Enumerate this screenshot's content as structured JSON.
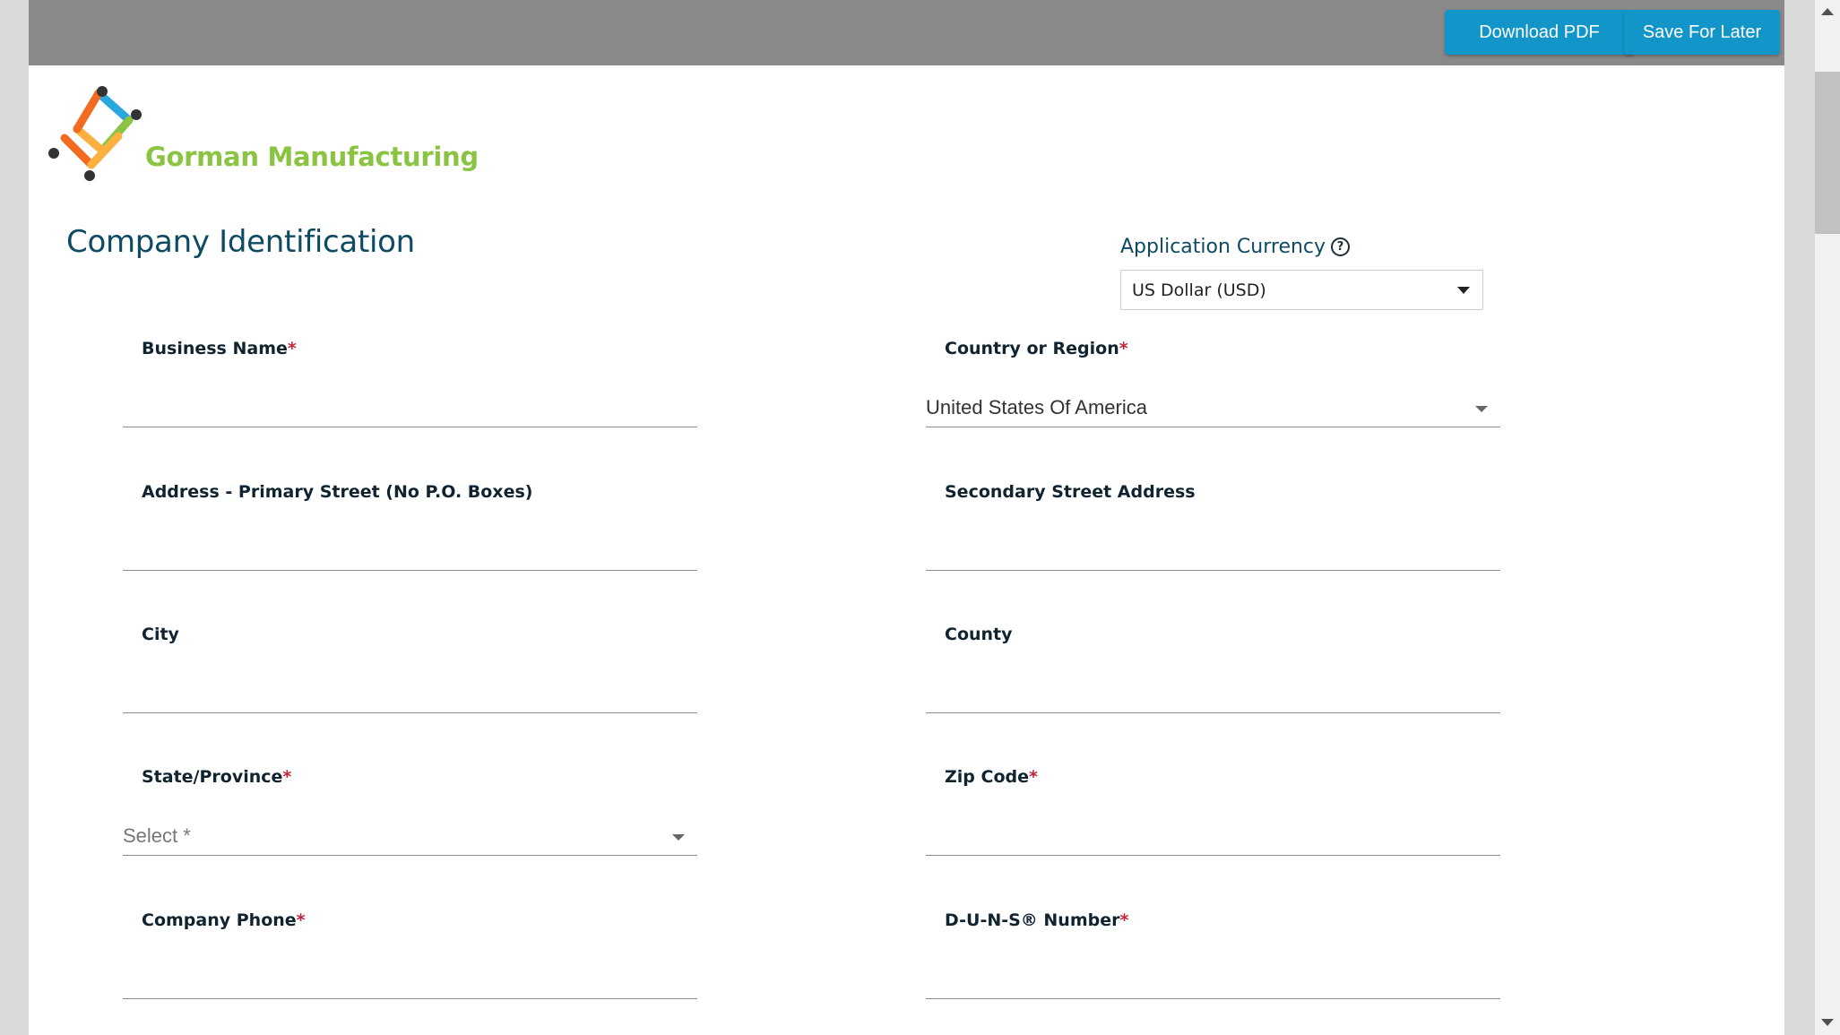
{
  "toolbar": {
    "download_pdf_label": "Download PDF",
    "save_later_label": "Save For Later"
  },
  "brand": {
    "name": "Gorman Manufacturing",
    "colors": {
      "name_green": "#8bc443",
      "logo_blue": "#29a8df",
      "logo_orange": "#f26b21",
      "logo_yellow": "#fbb040",
      "logo_green": "#8bc443",
      "logo_dots": "#333333"
    }
  },
  "section": {
    "title": "Company Identification"
  },
  "currency": {
    "label": "Application Currency",
    "help_icon": "help-circle-icon",
    "help_glyph": "?",
    "value": "US Dollar (USD)"
  },
  "fields": {
    "business_name": {
      "label": "Business Name",
      "required_mark": "*",
      "value": ""
    },
    "country": {
      "label": "Country or Region",
      "required_mark": "*",
      "value": "United States Of America"
    },
    "primary_street": {
      "label": "Address - Primary Street (No P.O. Boxes)",
      "value": ""
    },
    "secondary_street": {
      "label": "Secondary Street Address",
      "value": ""
    },
    "city": {
      "label": "City",
      "value": ""
    },
    "county": {
      "label": "County",
      "value": ""
    },
    "state": {
      "label": "State/Province",
      "required_mark": "*",
      "placeholder": "Select *"
    },
    "zip": {
      "label": "Zip Code",
      "required_mark": "*",
      "value": ""
    },
    "phone": {
      "label": "Company Phone",
      "required_mark": "*",
      "value": ""
    },
    "duns": {
      "label": "D-U-N-S® Number",
      "required_mark": "*",
      "value": ""
    }
  },
  "colors": {
    "topbar": "#898989",
    "button": "#1296c9",
    "heading": "#0d4a63",
    "required": "#c0243a"
  }
}
